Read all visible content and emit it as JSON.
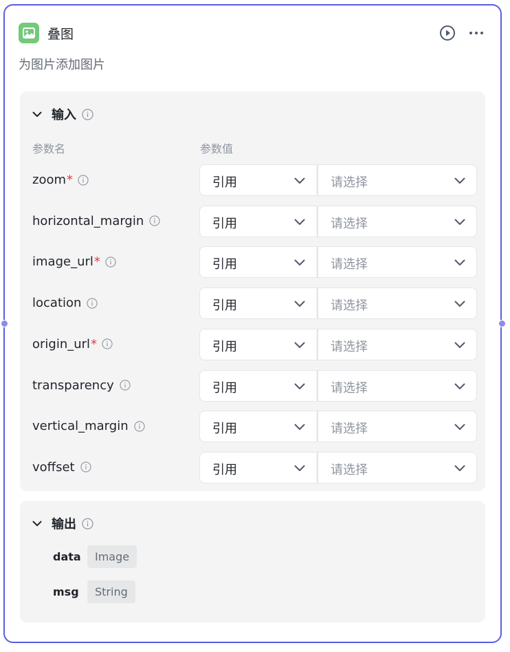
{
  "node": {
    "title": "叠图",
    "description": "为图片添加图片"
  },
  "input": {
    "section_label": "输入",
    "col_param_name": "参数名",
    "col_param_value": "参数值",
    "params": [
      {
        "name": "zoom",
        "required": "*",
        "ref": "引用",
        "placeholder": "请选择"
      },
      {
        "name": "horizontal_margin",
        "required": "",
        "ref": "引用",
        "placeholder": "请选择"
      },
      {
        "name": "image_url",
        "required": "*",
        "ref": "引用",
        "placeholder": "请选择"
      },
      {
        "name": "location",
        "required": "",
        "ref": "引用",
        "placeholder": "请选择"
      },
      {
        "name": "origin_url",
        "required": "*",
        "ref": "引用",
        "placeholder": "请选择"
      },
      {
        "name": "transparency",
        "required": "",
        "ref": "引用",
        "placeholder": "请选择"
      },
      {
        "name": "vertical_margin",
        "required": "",
        "ref": "引用",
        "placeholder": "请选择"
      },
      {
        "name": "voffset",
        "required": "",
        "ref": "引用",
        "placeholder": "请选择"
      }
    ]
  },
  "output": {
    "section_label": "输出",
    "items": [
      {
        "name": "data",
        "type": "Image"
      },
      {
        "name": "msg",
        "type": "String"
      }
    ]
  },
  "colors": {
    "border": "#5b5bde",
    "handle": "#8b8bec",
    "node_icon_bg": "#74c97b",
    "required": "#e5393b"
  },
  "icons": {
    "node": "image-icon",
    "run": "play-circle-icon",
    "more": "more-horizontal-icon",
    "collapse": "chevron-down-icon",
    "info": "info-icon",
    "dropdown": "chevron-down-icon"
  }
}
